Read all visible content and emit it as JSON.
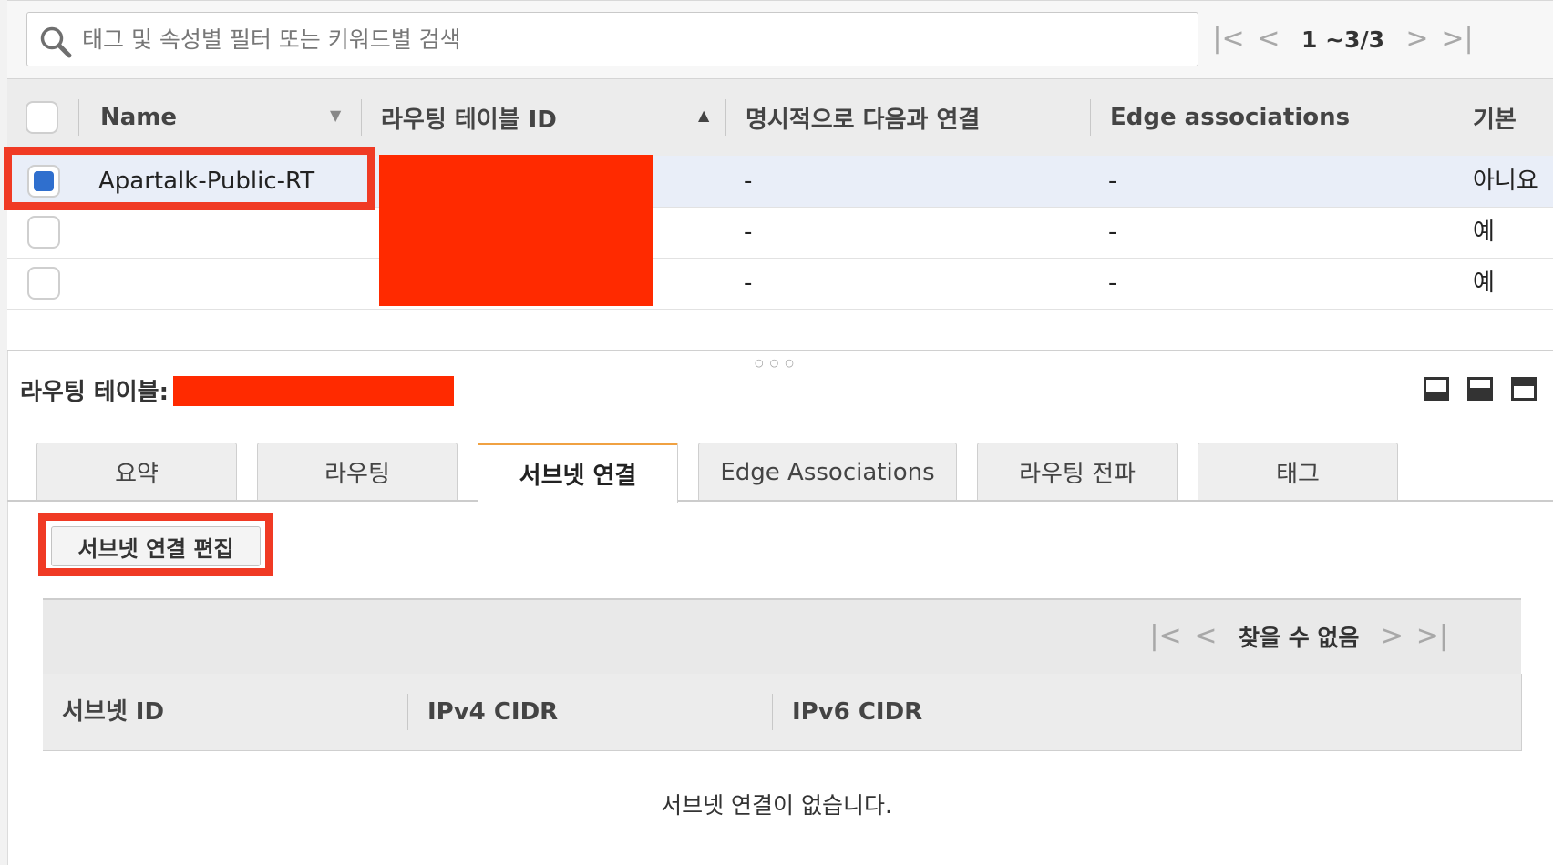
{
  "search": {
    "placeholder": "태그 및 속성별 필터 또는 키워드별 검색"
  },
  "pagination": {
    "range": "1 ~3/3"
  },
  "table": {
    "columns": [
      "Name",
      "라우팅 테이블 ID",
      "명시적으로 다음과 연결",
      "Edge associations",
      "기본"
    ],
    "rows": [
      {
        "name": "Apartalk-Public-RT",
        "explicit": "-",
        "edge": "-",
        "main": "아니요"
      },
      {
        "name": "",
        "explicit": "-",
        "edge": "-",
        "main": "예"
      },
      {
        "name": "",
        "explicit": "-",
        "edge": "-",
        "main": "예"
      }
    ]
  },
  "details": {
    "title": "라우팅 테이블:",
    "tabs": [
      "요약",
      "라우팅",
      "서브넷 연결",
      "Edge Associations",
      "라우팅 전파",
      "태그"
    ],
    "active_tab": "서브넷 연결",
    "edit_button": "서브넷 연결 편집",
    "subnet_pager": "찾을 수 없음",
    "subnet_columns": [
      "서브넷 ID",
      "IPv4 CIDR",
      "IPv6 CIDR"
    ],
    "empty_message": "서브넷 연결이 없습니다."
  },
  "colors": {
    "highlight": "#f03a24",
    "redaction": "#ff2a00",
    "active_tab_accent": "#f0a142",
    "checkbox_selected": "#2f6fce"
  }
}
